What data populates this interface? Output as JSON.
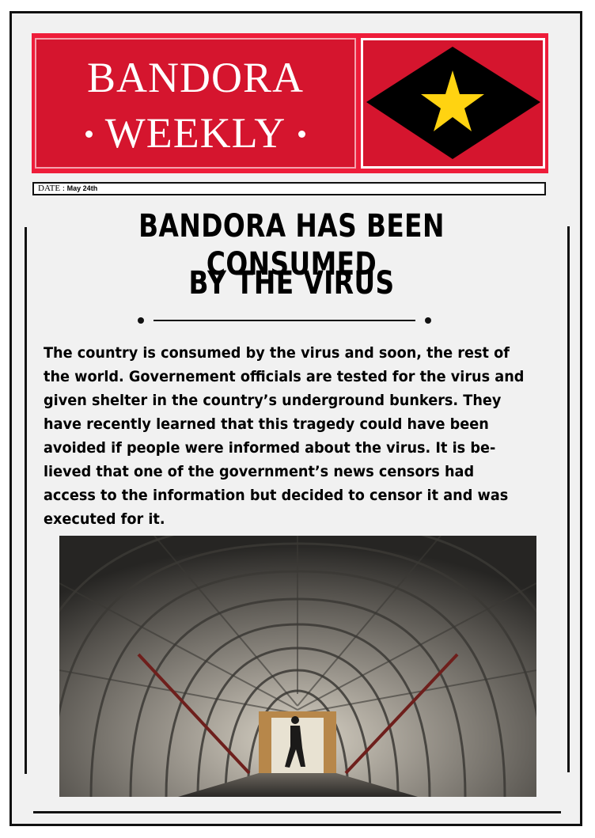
{
  "masthead": {
    "title_line1": "BANDORA",
    "title_line2": "WEEKLY",
    "emblem_icon": "diamond-star-emblem",
    "colors": {
      "red": "#ee1d3a",
      "dark_red": "#d5152e",
      "black": "#000000",
      "star_yellow": "#ffd311"
    }
  },
  "date_bar": {
    "label": "DATE :",
    "value": "May 24th"
  },
  "article": {
    "headline_line1": "BANDORA HAS BEEN CONSUMED",
    "headline_line2": "BY THE VIRUS",
    "body_lines": [
      "The country is consumed by the virus and soon, the rest of",
      "the world. Governement officials are tested for the virus and",
      "given shelter in the country’s underground bunkers. They",
      "have recently learned that this tragedy could have been",
      "avoided if people were informed about the virus. It is be-",
      "lieved that one of the government’s news censors had",
      "access to the information but decided to censor it and was",
      "executed for it."
    ]
  }
}
